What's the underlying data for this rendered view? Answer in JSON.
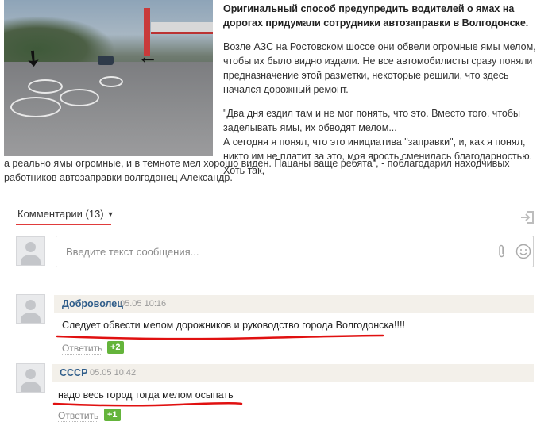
{
  "article": {
    "headline": "Оригинальный способ предупредить водителей о ямах на дорогах придумали сотрудники автозаправки в Волгодонске.",
    "paragraph1": "Возле АЗС на Ростовском шоссе они обвели огромные ямы мелом, чтобы их было видно издали. Не все автомобилисты сразу поняли предназначение этой разметки, некоторые решили, что здесь начался дорожный ремонт.",
    "quote_line1": "\"Два дня ездил там и не мог понять, что это. Вместо того, чтобы заделывать ямы, их обводят мелом...",
    "quote_line2": "А сегодня я понял, что это инициатива \"заправки\", и, как я понял, никто им не платит за это, моя ярость сменилась благодарностью. Хоть так,",
    "quote_cont": "а реально ямы огромные, и в темноте мел хорошо виден. Пацаны ваще ребята\", - поблагодарил находчивых работников автозаправки волгодонец Александр."
  },
  "comments_header": {
    "label": "Комментарии (13)",
    "caret": "▼"
  },
  "message_input": {
    "placeholder": "Введите текст сообщения..."
  },
  "comments": [
    {
      "author": "Доброволец",
      "date": "05.05 10:16",
      "text": "Следует обвести мелом дорожников и руководство города Волгодонска!!!!",
      "reply_label": "Ответить",
      "rating": "+2"
    },
    {
      "author": "СССР",
      "date": "05.05 10:42",
      "text": "надо весь город тогда мелом осыпать",
      "reply_label": "Ответить",
      "rating": "+1"
    }
  ],
  "colors": {
    "accent_red": "#e03b3b",
    "author_blue": "#2f5d8a",
    "rating_green": "#64b43b",
    "comment_bar_bg": "#f3f0ea"
  },
  "icons": [
    "login-icon",
    "paperclip-icon",
    "smiley-icon",
    "avatar-placeholder"
  ]
}
